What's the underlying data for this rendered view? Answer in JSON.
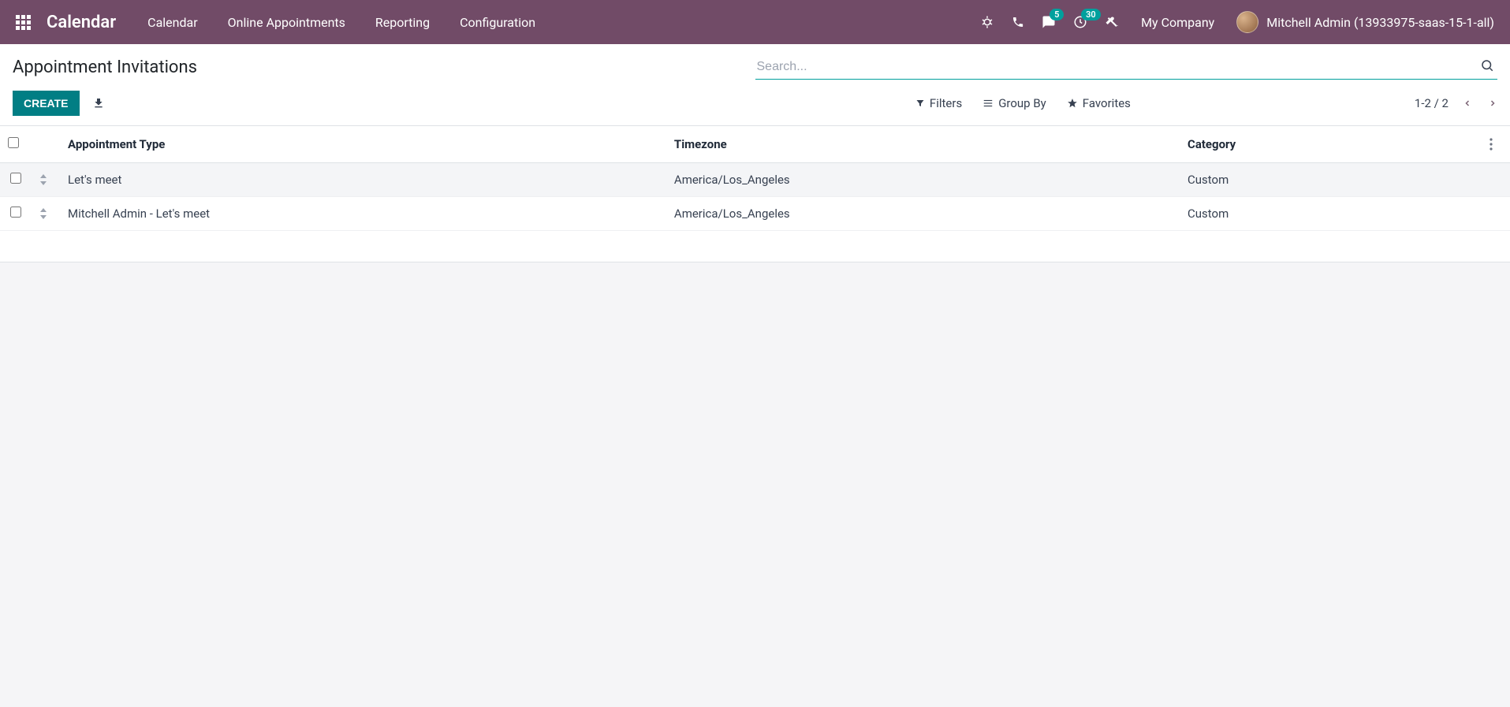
{
  "topbar": {
    "brand": "Calendar",
    "menu": [
      "Calendar",
      "Online Appointments",
      "Reporting",
      "Configuration"
    ],
    "company": "My Company",
    "user": "Mitchell Admin (13933975-saas-15-1-all)",
    "badge_messages": "5",
    "badge_activities": "30"
  },
  "control": {
    "title": "Appointment Invitations",
    "search_placeholder": "Search...",
    "create_label": "CREATE",
    "filters_label": "Filters",
    "groupby_label": "Group By",
    "favorites_label": "Favorites",
    "pager": "1-2 / 2"
  },
  "table": {
    "headers": {
      "type": "Appointment Type",
      "tz": "Timezone",
      "cat": "Category"
    },
    "rows": [
      {
        "type": "Let's meet",
        "tz": "America/Los_Angeles",
        "cat": "Custom"
      },
      {
        "type": "Mitchell Admin - Let's meet",
        "tz": "America/Los_Angeles",
        "cat": "Custom"
      }
    ]
  }
}
